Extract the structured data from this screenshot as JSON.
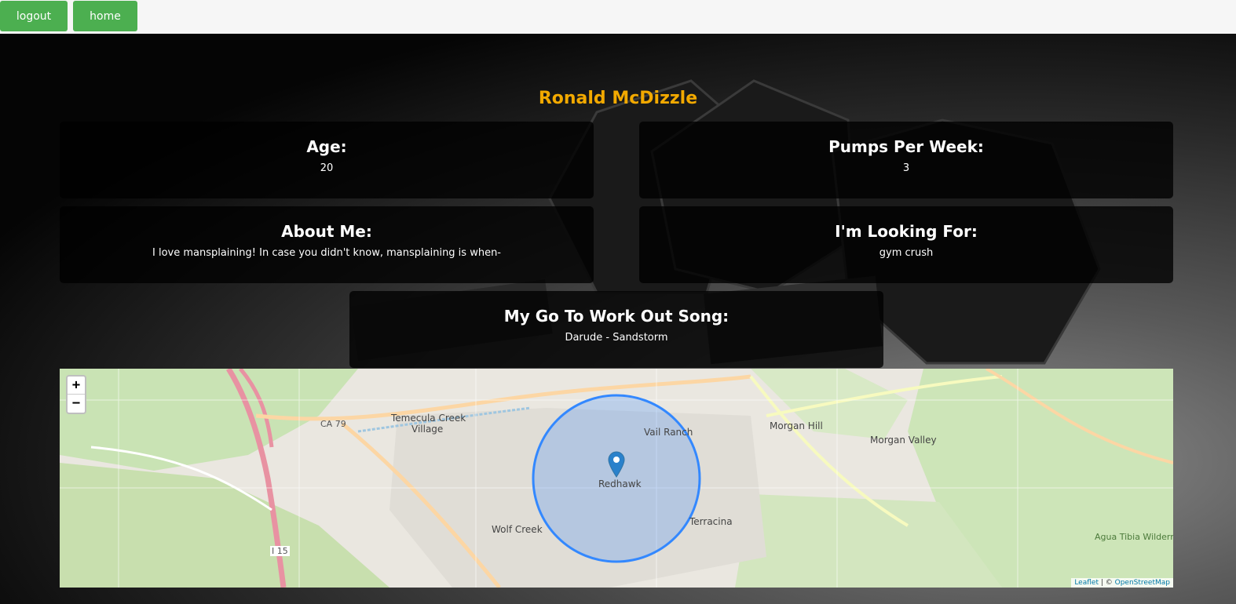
{
  "nav": {
    "logout_label": "logout",
    "home_label": "home"
  },
  "profile": {
    "name": "Ronald McDizzle",
    "age": {
      "label": "Age:",
      "value": "20"
    },
    "pumps": {
      "label": "Pumps Per Week:",
      "value": "3"
    },
    "about": {
      "label": "About Me:",
      "value": "I love mansplaining! In case you didn't know, mansplaining is when-"
    },
    "looking": {
      "label": "I'm Looking For:",
      "value": "gym crush"
    },
    "song": {
      "label": "My Go To Work Out Song:",
      "value": "Darude - Sandstorm"
    }
  },
  "map": {
    "zoom_in": "+",
    "zoom_out": "−",
    "attribution_leaflet": "Leaflet",
    "attribution_sep": " | © ",
    "attribution_osm": "OpenStreetMap",
    "labels": {
      "temecula_creek": "Temecula Creek",
      "village": "Village",
      "vail_ranch": "Vail Ranch",
      "morgan_hill": "Morgan Hill",
      "morgan_valley": "Morgan Valley",
      "redhawk": "Redhawk",
      "wolf_creek": "Wolf Creek",
      "terracina": "Terracina",
      "agua_tibia": "Agua Tibia Wilderness",
      "ca79": "CA 79",
      "i15": "I 15"
    }
  },
  "colors": {
    "accent": "#f2a900",
    "button": "#4caf50",
    "circle": "#3388ff"
  }
}
